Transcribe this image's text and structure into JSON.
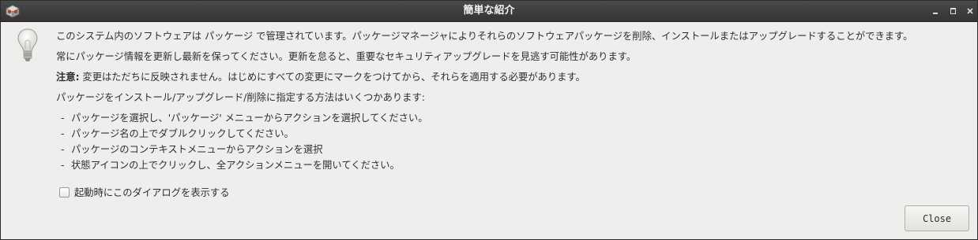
{
  "window": {
    "title": "簡単な紹介"
  },
  "content": {
    "line1": "このシステム内のソフトウェアは パッケージ で管理されています。パッケージマネージャによりそれらのソフトウェアパッケージを削除、インストールまたはアップグレードすることができます。",
    "line2": "常にパッケージ情報を更新し最新を保ってください。更新を怠ると、重要なセキュリティアップグレードを見逃す可能性があります。",
    "note_label": "注意:",
    "note_text": " 変更はただちに反映されません。はじめにすべての変更にマークをつけてから、それらを適用する必要があります。",
    "methods_intro": "パッケージをインストール/アップグレード/削除に指定する方法はいくつかあります:",
    "methods": [
      "パッケージを選択し、'パッケージ' メニューからアクションを選択してください。",
      "パッケージ名の上でダブルクリックしてください。",
      "パッケージのコンテキストメニューからアクションを選択",
      "状態アイコンの上でクリックし、全アクションメニューを開いてください。"
    ],
    "list_dash": "-"
  },
  "startup_checkbox": {
    "label": "起動時にこのダイアログを表示する",
    "checked": false
  },
  "buttons": {
    "close": "Close"
  },
  "icons": {
    "app": "synaptic-box-icon",
    "hint": "lightbulb-icon"
  }
}
